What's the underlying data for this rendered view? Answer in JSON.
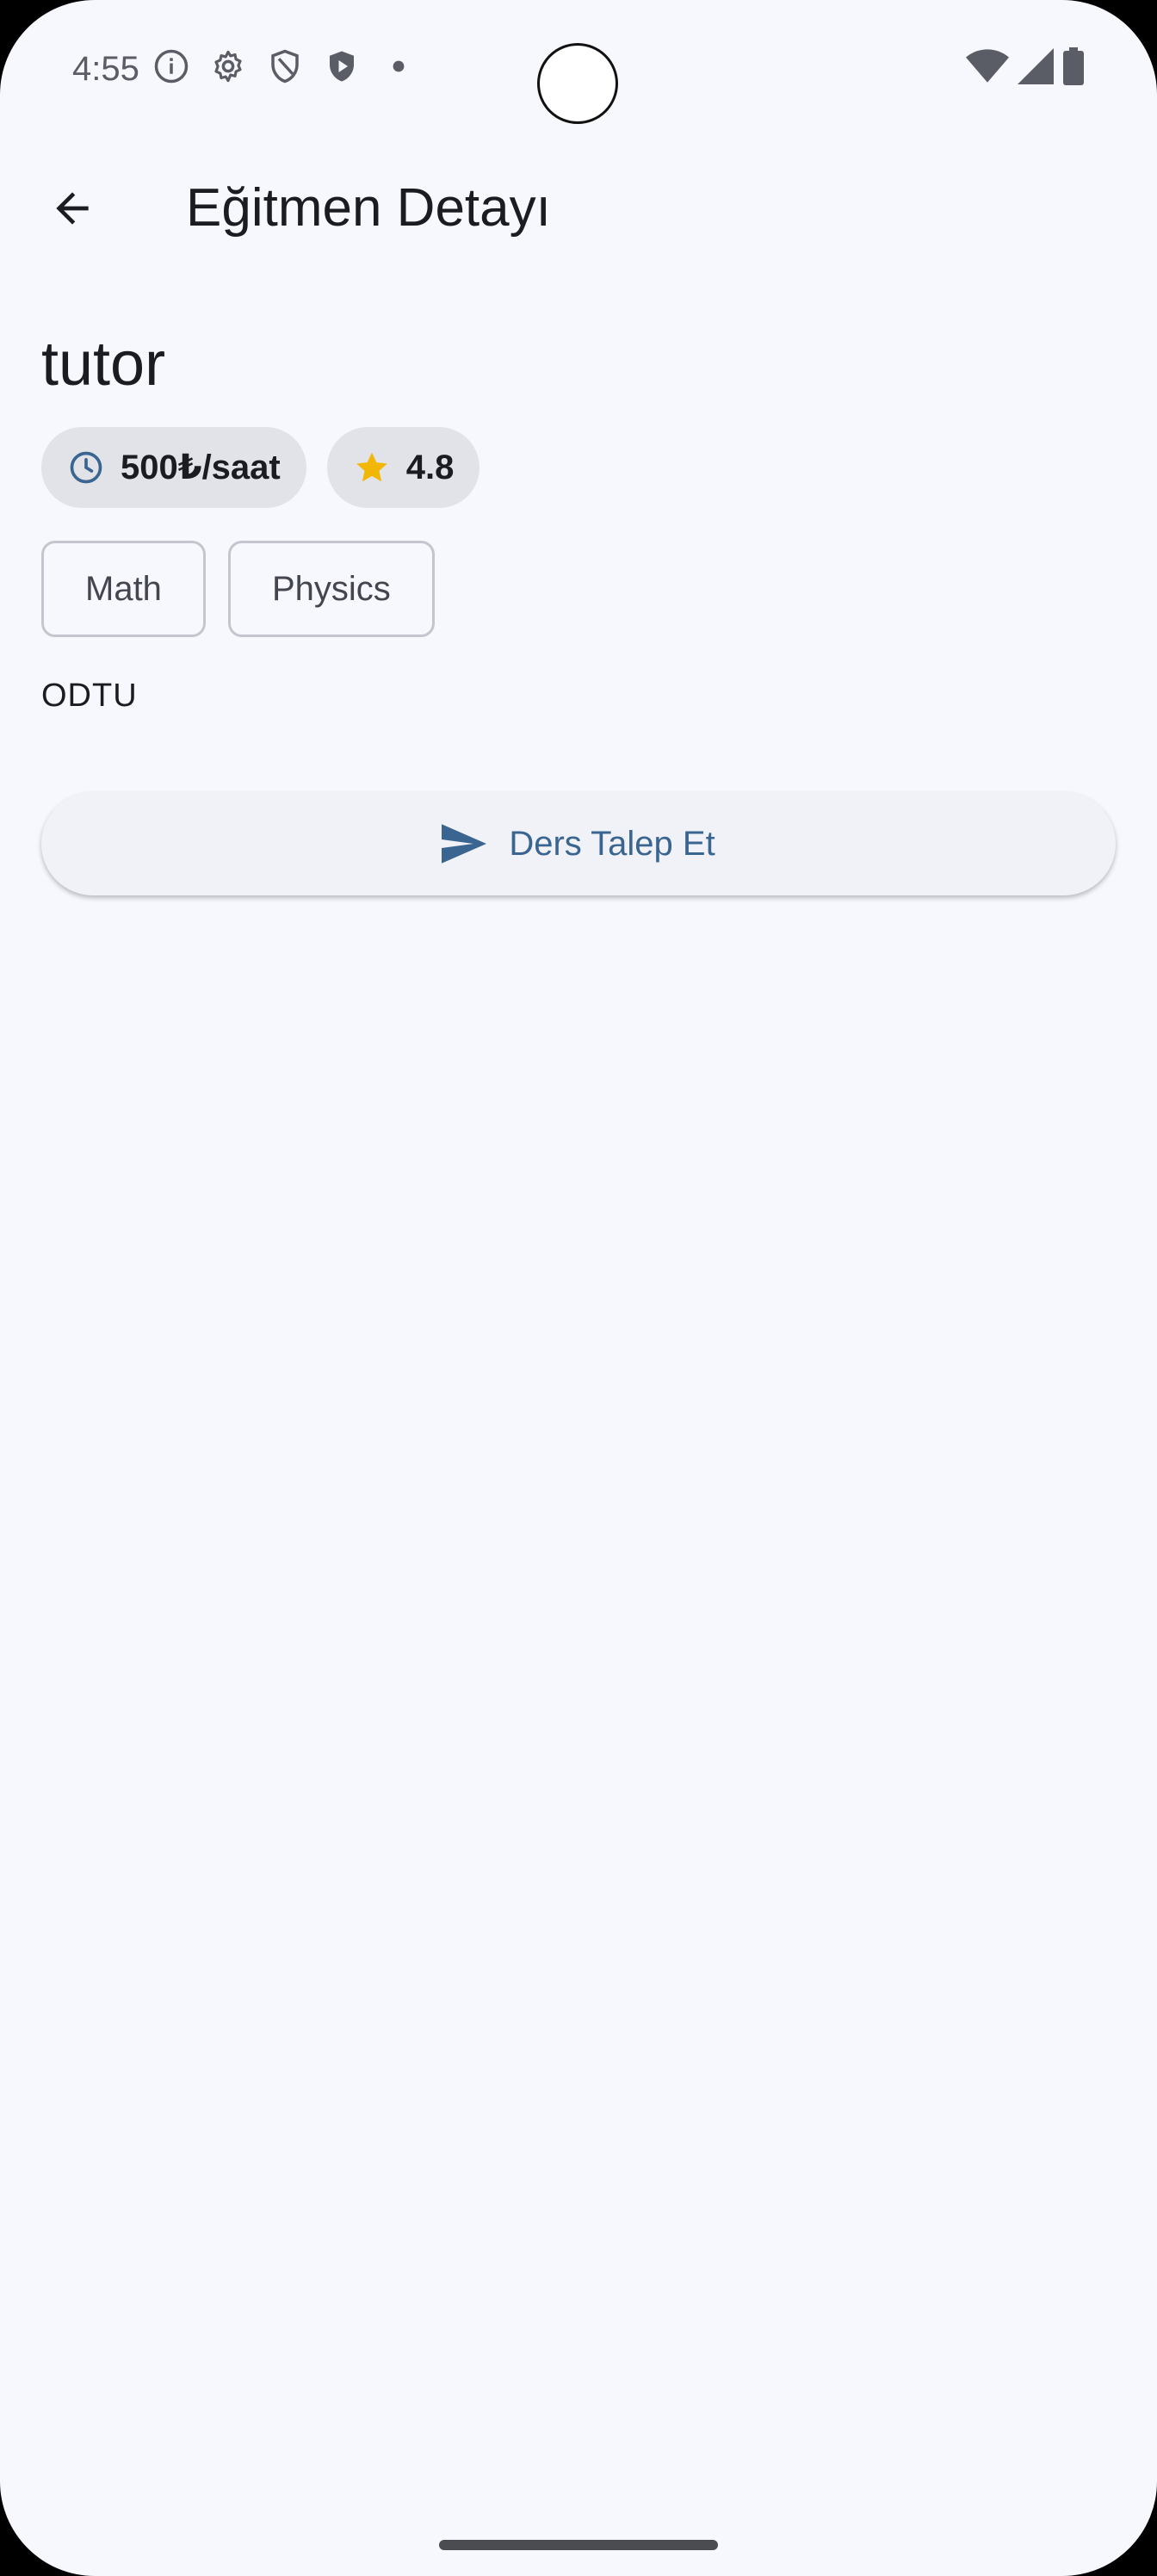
{
  "status_bar": {
    "time": "4:55",
    "left_icons": [
      "info-icon",
      "settings-gear-icon",
      "shield-icon",
      "play-shield-icon",
      "dot-icon"
    ],
    "right_icons": [
      "wifi-icon",
      "cell-signal-icon",
      "battery-icon"
    ]
  },
  "app_bar": {
    "title": "Eğitmen Detayı",
    "back_icon": "arrow-back-icon"
  },
  "tutor": {
    "name": "tutor",
    "rate": "500₺/saat",
    "rate_icon": "clock-icon",
    "rating": "4.8",
    "rating_icon": "star-icon",
    "subjects": [
      "Math",
      "Physics"
    ],
    "university": "ODTU"
  },
  "request_button": {
    "label": "Ders Talep Et",
    "icon": "send-icon"
  },
  "colors": {
    "background": "#f7f8fd",
    "accent": "#3a6590",
    "star": "#f2b705",
    "chip_bg": "#e2e3e9",
    "text": "#1b1c21"
  }
}
